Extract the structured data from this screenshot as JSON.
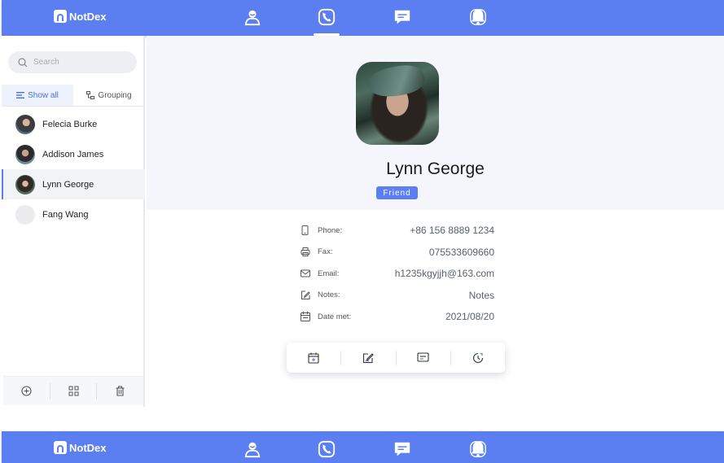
{
  "app": {
    "name": "NotDex"
  },
  "nav": {
    "items": [
      {
        "icon": "person-icon",
        "label": "Contacts"
      },
      {
        "icon": "phone-icon",
        "label": "Calls",
        "active": true
      },
      {
        "icon": "chat-icon",
        "label": "Messages"
      },
      {
        "icon": "bell-icon",
        "label": "Notifications"
      }
    ]
  },
  "sidebar": {
    "search": {
      "placeholder": "Search"
    },
    "tabs": [
      {
        "label": "Show all",
        "active": true
      },
      {
        "label": "Grouping"
      }
    ],
    "contacts": [
      {
        "name": "Felecia Burke"
      },
      {
        "name": "Addison James"
      },
      {
        "name": "Lynn George",
        "active": true
      },
      {
        "name": "Fang Wang"
      }
    ],
    "footer": [
      "add-icon",
      "grid-icon",
      "trash-icon"
    ]
  },
  "detail": {
    "name": "Lynn George",
    "tag": "Friend",
    "fields": [
      {
        "icon": "phone-icon",
        "label": "Phone:",
        "value": "+86 156 8889 1234"
      },
      {
        "icon": "fax-icon",
        "label": "Fax:",
        "value": "075533609660"
      },
      {
        "icon": "mail-icon",
        "label": "Email:",
        "value": "h1235kgyjjh@163.com"
      },
      {
        "icon": "edit-icon",
        "label": "Notes:",
        "value": "Notes"
      },
      {
        "icon": "calendar-icon",
        "label": "Date met:",
        "value": "2021/08/20"
      }
    ],
    "actions": [
      "calendar-add-icon",
      "edit-icon",
      "message-icon",
      "history-icon"
    ]
  },
  "colors": {
    "accent": "#5b7ff0",
    "panel": "#f4f6fb"
  }
}
